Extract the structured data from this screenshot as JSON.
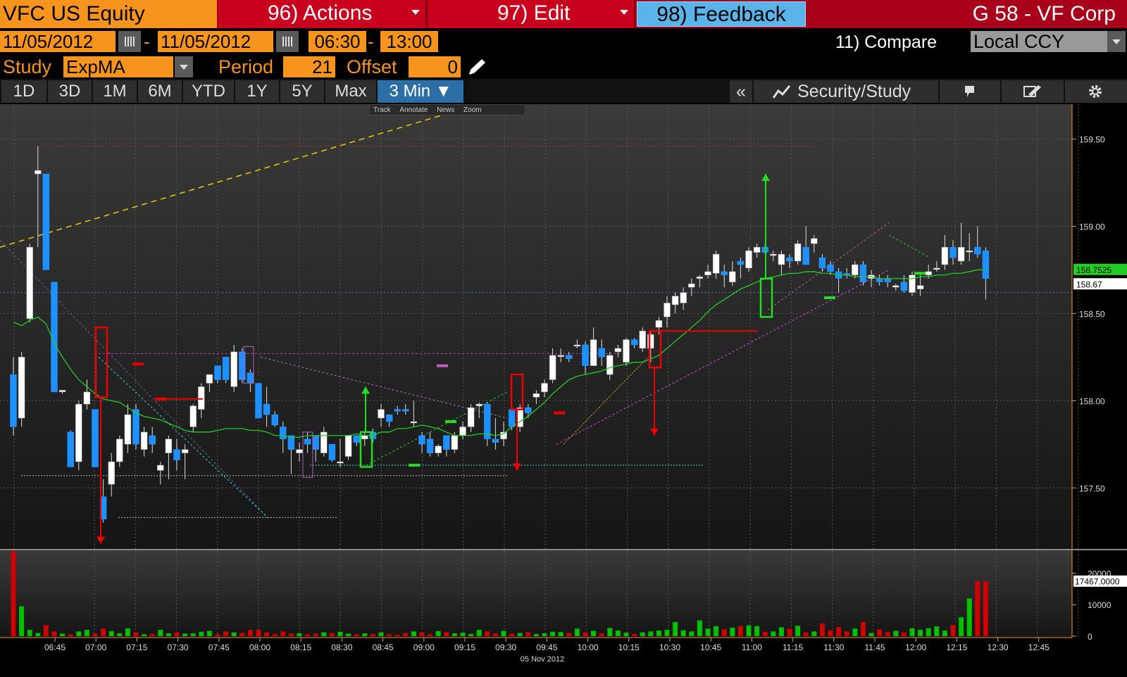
{
  "header": {
    "ticker": "VFC US Equity",
    "actions_label": "96) Actions",
    "edit_label": "97) Edit",
    "feedback_label": "98) Feedback",
    "security_title": "G 58 - VF Corp"
  },
  "range": {
    "start_date": "11/05/2012",
    "end_date": "11/05/2012",
    "start_time": "06:30",
    "end_time": "13:00",
    "separator": "-",
    "compare_label": "11) Compare",
    "currency": "Local CCY"
  },
  "study": {
    "label": "Study",
    "value": "ExpMA",
    "period_label": "Period",
    "period_value": "21",
    "offset_label": "Offset",
    "offset_value": "0"
  },
  "tabs": [
    "1D",
    "3D",
    "1M",
    "6M",
    "YTD",
    "1Y",
    "5Y",
    "Max",
    "3 Min ▼"
  ],
  "active_tab": "3 Min ▼",
  "toolbar": {
    "collapse": "«",
    "security_study": "Security/Study",
    "mini_tools": [
      "Track",
      "Annotate",
      "News",
      "Zoom"
    ]
  },
  "colors": {
    "up_candle": "#ffffff",
    "down_candle": "#1e90ff",
    "ema_line": "#22cc22",
    "price_tag": "#22cc22",
    "volume_up": "#00c000",
    "volume_down": "#d00000",
    "orange": "#f7941d"
  },
  "chart_data": {
    "type": "candlestick",
    "x_date_label": "05 Nov 2012",
    "x_ticks": [
      "06:45",
      "07:00",
      "07:15",
      "07:30",
      "07:45",
      "08:00",
      "08:15",
      "08:30",
      "08:45",
      "09:00",
      "09:15",
      "09:30",
      "09:45",
      "10:00",
      "10:15",
      "10:30",
      "10:45",
      "11:00",
      "11:15",
      "11:30",
      "11:45",
      "12:00",
      "12:15",
      "12:30",
      "12:45"
    ],
    "y_ticks": [
      "159.50",
      "159.00",
      "158.50",
      "158.00",
      "157.50"
    ],
    "ylim": [
      157.15,
      159.7
    ],
    "last_price": "158.67",
    "ema_value": "158.7525",
    "volume_ticks": [
      "20000",
      "10000",
      "0"
    ],
    "volume_last": "17467.0000",
    "volume_ylim": [
      0,
      25000
    ],
    "candles": [
      {
        "o": 158.15,
        "h": 158.25,
        "l": 157.8,
        "c": 157.85
      },
      {
        "o": 157.9,
        "h": 158.28,
        "l": 157.85,
        "c": 158.25
      },
      {
        "o": 158.47,
        "h": 158.9,
        "l": 158.45,
        "c": 158.88
      },
      {
        "o": 159.3,
        "h": 159.46,
        "l": 158.88,
        "c": 159.32
      },
      {
        "o": 159.3,
        "h": 159.3,
        "l": 158.75,
        "c": 158.75
      },
      {
        "o": 158.68,
        "h": 158.68,
        "l": 158.05,
        "c": 158.05
      },
      {
        "o": 158.05,
        "h": 158.06,
        "l": 158.04,
        "c": 158.06
      },
      {
        "o": 157.82,
        "h": 157.83,
        "l": 157.62,
        "c": 157.62
      },
      {
        "o": 157.65,
        "h": 158.0,
        "l": 157.6,
        "c": 157.98
      },
      {
        "o": 157.98,
        "h": 158.12,
        "l": 157.95,
        "c": 158.05
      },
      {
        "o": 157.95,
        "h": 157.95,
        "l": 157.62,
        "c": 157.62
      },
      {
        "o": 157.45,
        "h": 157.55,
        "l": 157.3,
        "c": 157.32
      },
      {
        "o": 157.52,
        "h": 157.7,
        "l": 157.45,
        "c": 157.65
      },
      {
        "o": 157.65,
        "h": 157.8,
        "l": 157.62,
        "c": 157.78
      },
      {
        "o": 157.75,
        "h": 157.98,
        "l": 157.7,
        "c": 157.92
      },
      {
        "o": 157.95,
        "h": 157.98,
        "l": 157.72,
        "c": 157.75
      },
      {
        "o": 157.72,
        "h": 157.85,
        "l": 157.68,
        "c": 157.82
      },
      {
        "o": 157.8,
        "h": 157.85,
        "l": 157.7,
        "c": 157.75
      },
      {
        "o": 157.6,
        "h": 157.65,
        "l": 157.52,
        "c": 157.63
      },
      {
        "o": 157.7,
        "h": 157.8,
        "l": 157.55,
        "c": 157.78
      },
      {
        "o": 157.72,
        "h": 157.78,
        "l": 157.6,
        "c": 157.66
      },
      {
        "o": 157.7,
        "h": 157.75,
        "l": 157.55,
        "c": 157.72
      },
      {
        "o": 157.85,
        "h": 157.98,
        "l": 157.82,
        "c": 157.97
      },
      {
        "o": 157.95,
        "h": 158.1,
        "l": 157.9,
        "c": 158.08
      },
      {
        "o": 158.1,
        "h": 158.15,
        "l": 158.05,
        "c": 158.15
      },
      {
        "o": 158.2,
        "h": 158.2,
        "l": 158.1,
        "c": 158.12
      },
      {
        "o": 158.25,
        "h": 158.25,
        "l": 158.1,
        "c": 158.12
      },
      {
        "o": 158.08,
        "h": 158.32,
        "l": 158.05,
        "c": 158.28
      },
      {
        "o": 158.28,
        "h": 158.3,
        "l": 158.1,
        "c": 158.12
      },
      {
        "o": 158.16,
        "h": 158.18,
        "l": 158.05,
        "c": 158.1
      },
      {
        "o": 158.1,
        "h": 158.1,
        "l": 157.9,
        "c": 157.9
      },
      {
        "o": 157.98,
        "h": 158.08,
        "l": 157.85,
        "c": 157.92
      },
      {
        "o": 157.92,
        "h": 157.94,
        "l": 157.85,
        "c": 157.86
      },
      {
        "o": 157.85,
        "h": 157.88,
        "l": 157.7,
        "c": 157.78
      },
      {
        "o": 157.8,
        "h": 157.8,
        "l": 157.58,
        "c": 157.72
      },
      {
        "o": 157.7,
        "h": 157.76,
        "l": 157.65,
        "c": 157.72
      },
      {
        "o": 157.78,
        "h": 157.82,
        "l": 157.7,
        "c": 157.75
      },
      {
        "o": 157.8,
        "h": 157.8,
        "l": 157.65,
        "c": 157.72
      },
      {
        "o": 157.7,
        "h": 157.85,
        "l": 157.68,
        "c": 157.82
      },
      {
        "o": 157.75,
        "h": 157.75,
        "l": 157.65,
        "c": 157.66
      },
      {
        "o": 157.65,
        "h": 157.78,
        "l": 157.62,
        "c": 157.65
      },
      {
        "o": 157.68,
        "h": 157.8,
        "l": 157.66,
        "c": 157.8
      },
      {
        "o": 157.8,
        "h": 157.8,
        "l": 157.74,
        "c": 157.76
      },
      {
        "o": 157.78,
        "h": 157.82,
        "l": 157.74,
        "c": 157.8
      },
      {
        "o": 157.82,
        "h": 157.84,
        "l": 157.76,
        "c": 157.78
      },
      {
        "o": 157.9,
        "h": 157.98,
        "l": 157.85,
        "c": 157.95
      },
      {
        "o": 157.92,
        "h": 157.92,
        "l": 157.85,
        "c": 157.88
      },
      {
        "o": 157.95,
        "h": 157.97,
        "l": 157.92,
        "c": 157.94
      },
      {
        "o": 157.95,
        "h": 157.98,
        "l": 157.92,
        "c": 157.94
      },
      {
        "o": 157.88,
        "h": 158.0,
        "l": 157.85,
        "c": 157.88
      },
      {
        "o": 157.8,
        "h": 157.82,
        "l": 157.7,
        "c": 157.75
      },
      {
        "o": 157.78,
        "h": 157.82,
        "l": 157.68,
        "c": 157.7
      },
      {
        "o": 157.7,
        "h": 157.75,
        "l": 157.68,
        "c": 157.74
      },
      {
        "o": 157.8,
        "h": 157.8,
        "l": 157.68,
        "c": 157.72
      },
      {
        "o": 157.72,
        "h": 157.82,
        "l": 157.7,
        "c": 157.8
      },
      {
        "o": 157.8,
        "h": 157.88,
        "l": 157.78,
        "c": 157.85
      },
      {
        "o": 157.85,
        "h": 157.98,
        "l": 157.82,
        "c": 157.96
      },
      {
        "o": 157.97,
        "h": 157.99,
        "l": 157.9,
        "c": 157.98
      },
      {
        "o": 157.98,
        "h": 157.99,
        "l": 157.74,
        "c": 157.78
      },
      {
        "o": 157.78,
        "h": 157.9,
        "l": 157.72,
        "c": 157.76
      },
      {
        "o": 157.78,
        "h": 157.88,
        "l": 157.74,
        "c": 157.82
      },
      {
        "o": 157.95,
        "h": 157.97,
        "l": 157.83,
        "c": 157.85
      },
      {
        "o": 157.85,
        "h": 157.98,
        "l": 157.82,
        "c": 157.96
      },
      {
        "o": 157.96,
        "h": 157.98,
        "l": 157.9,
        "c": 157.93
      },
      {
        "o": 158.02,
        "h": 158.06,
        "l": 157.98,
        "c": 158.04
      },
      {
        "o": 158.05,
        "h": 158.12,
        "l": 158.02,
        "c": 158.1
      },
      {
        "o": 158.12,
        "h": 158.3,
        "l": 158.1,
        "c": 158.26
      },
      {
        "o": 158.26,
        "h": 158.3,
        "l": 158.22,
        "c": 158.26
      },
      {
        "o": 158.26,
        "h": 158.28,
        "l": 158.22,
        "c": 158.24
      },
      {
        "o": 158.32,
        "h": 158.35,
        "l": 158.3,
        "c": 158.32
      },
      {
        "o": 158.32,
        "h": 158.34,
        "l": 158.15,
        "c": 158.2
      },
      {
        "o": 158.2,
        "h": 158.42,
        "l": 158.2,
        "c": 158.35
      },
      {
        "o": 158.3,
        "h": 158.35,
        "l": 158.2,
        "c": 158.25
      },
      {
        "o": 158.15,
        "h": 158.28,
        "l": 158.12,
        "c": 158.26
      },
      {
        "o": 158.28,
        "h": 158.32,
        "l": 158.25,
        "c": 158.3
      },
      {
        "o": 158.22,
        "h": 158.36,
        "l": 158.2,
        "c": 158.35
      },
      {
        "o": 158.35,
        "h": 158.36,
        "l": 158.3,
        "c": 158.32
      },
      {
        "o": 158.3,
        "h": 158.42,
        "l": 158.28,
        "c": 158.4
      },
      {
        "o": 158.3,
        "h": 158.4,
        "l": 158.22,
        "c": 158.38
      },
      {
        "o": 158.42,
        "h": 158.48,
        "l": 158.38,
        "c": 158.46
      },
      {
        "o": 158.48,
        "h": 158.6,
        "l": 158.42,
        "c": 158.56
      },
      {
        "o": 158.55,
        "h": 158.62,
        "l": 158.5,
        "c": 158.6
      },
      {
        "o": 158.56,
        "h": 158.65,
        "l": 158.52,
        "c": 158.62
      },
      {
        "o": 158.65,
        "h": 158.7,
        "l": 158.6,
        "c": 158.67
      },
      {
        "o": 158.7,
        "h": 158.72,
        "l": 158.65,
        "c": 158.71
      },
      {
        "o": 158.72,
        "h": 158.78,
        "l": 158.7,
        "c": 158.74
      },
      {
        "o": 158.73,
        "h": 158.86,
        "l": 158.7,
        "c": 158.84
      },
      {
        "o": 158.74,
        "h": 158.78,
        "l": 158.65,
        "c": 158.72
      },
      {
        "o": 158.68,
        "h": 158.8,
        "l": 158.66,
        "c": 158.74
      },
      {
        "o": 158.8,
        "h": 158.82,
        "l": 158.7,
        "c": 158.78
      },
      {
        "o": 158.76,
        "h": 158.88,
        "l": 158.74,
        "c": 158.86
      },
      {
        "o": 158.85,
        "h": 158.9,
        "l": 158.82,
        "c": 158.88
      },
      {
        "o": 158.88,
        "h": 158.9,
        "l": 158.84,
        "c": 158.85
      },
      {
        "o": 158.84,
        "h": 158.86,
        "l": 158.8,
        "c": 158.84
      },
      {
        "o": 158.78,
        "h": 158.86,
        "l": 158.72,
        "c": 158.84
      },
      {
        "o": 158.82,
        "h": 158.84,
        "l": 158.76,
        "c": 158.8
      },
      {
        "o": 158.8,
        "h": 158.92,
        "l": 158.78,
        "c": 158.9
      },
      {
        "o": 158.88,
        "h": 159.0,
        "l": 158.78,
        "c": 158.78
      },
      {
        "o": 158.9,
        "h": 158.95,
        "l": 158.85,
        "c": 158.93
      },
      {
        "o": 158.82,
        "h": 158.84,
        "l": 158.74,
        "c": 158.76
      },
      {
        "o": 158.78,
        "h": 158.8,
        "l": 158.72,
        "c": 158.74
      },
      {
        "o": 158.74,
        "h": 158.76,
        "l": 158.62,
        "c": 158.7
      },
      {
        "o": 158.73,
        "h": 158.76,
        "l": 158.7,
        "c": 158.72
      },
      {
        "o": 158.72,
        "h": 158.8,
        "l": 158.7,
        "c": 158.78
      },
      {
        "o": 158.78,
        "h": 158.8,
        "l": 158.66,
        "c": 158.68
      },
      {
        "o": 158.7,
        "h": 158.75,
        "l": 158.65,
        "c": 158.72
      },
      {
        "o": 158.7,
        "h": 158.72,
        "l": 158.66,
        "c": 158.68
      },
      {
        "o": 158.7,
        "h": 158.72,
        "l": 158.65,
        "c": 158.68
      },
      {
        "o": 158.65,
        "h": 158.67,
        "l": 158.63,
        "c": 158.66
      },
      {
        "o": 158.68,
        "h": 158.72,
        "l": 158.62,
        "c": 158.63
      },
      {
        "o": 158.62,
        "h": 158.74,
        "l": 158.6,
        "c": 158.72
      },
      {
        "o": 158.64,
        "h": 158.72,
        "l": 158.6,
        "c": 158.66
      },
      {
        "o": 158.72,
        "h": 158.78,
        "l": 158.7,
        "c": 158.74
      },
      {
        "o": 158.76,
        "h": 158.8,
        "l": 158.74,
        "c": 158.76
      },
      {
        "o": 158.78,
        "h": 158.95,
        "l": 158.75,
        "c": 158.88
      },
      {
        "o": 158.88,
        "h": 158.92,
        "l": 158.78,
        "c": 158.82
      },
      {
        "o": 158.8,
        "h": 159.02,
        "l": 158.78,
        "c": 158.88
      },
      {
        "o": 158.86,
        "h": 158.96,
        "l": 158.8,
        "c": 158.86
      },
      {
        "o": 158.88,
        "h": 159.0,
        "l": 158.82,
        "c": 158.84
      },
      {
        "o": 158.86,
        "h": 158.88,
        "l": 158.58,
        "c": 158.7
      }
    ],
    "ema": [
      158.45,
      158.43,
      158.46,
      158.48,
      158.44,
      158.33,
      158.25,
      158.18,
      158.12,
      158.08,
      158.04,
      158.01,
      158.0,
      157.99,
      157.96,
      157.93,
      157.91,
      157.9,
      157.89,
      157.87,
      157.85,
      157.83,
      157.82,
      157.82,
      157.82,
      157.83,
      157.84,
      157.84,
      157.84,
      157.83,
      157.83,
      157.82,
      157.8,
      157.8,
      157.79,
      157.79,
      157.8,
      157.8,
      157.8,
      157.8,
      157.8,
      157.8,
      157.81,
      157.8,
      157.8,
      157.82,
      157.82,
      157.84,
      157.84,
      157.85,
      157.86,
      157.85,
      157.84,
      157.82,
      157.8,
      157.8,
      157.8,
      157.81,
      157.81,
      157.8,
      157.81,
      157.85,
      157.88,
      157.91,
      157.95,
      157.99,
      158.04,
      158.08,
      158.12,
      158.14,
      158.15,
      158.16,
      158.17,
      158.19,
      158.2,
      158.21,
      158.22,
      158.22,
      158.24,
      158.26,
      158.3,
      158.34,
      158.38,
      158.42,
      158.46,
      158.51,
      158.55,
      158.58,
      158.61,
      158.64,
      158.66,
      158.68,
      158.7,
      158.71,
      158.72,
      158.73,
      158.73,
      158.74,
      158.74,
      158.73,
      158.73,
      158.72,
      158.72,
      158.71,
      158.71,
      158.71,
      158.7,
      158.7,
      158.7,
      158.7,
      158.7,
      158.71,
      158.71,
      158.72,
      158.72,
      158.73,
      158.73,
      158.74,
      158.75,
      158.75
    ]
  }
}
